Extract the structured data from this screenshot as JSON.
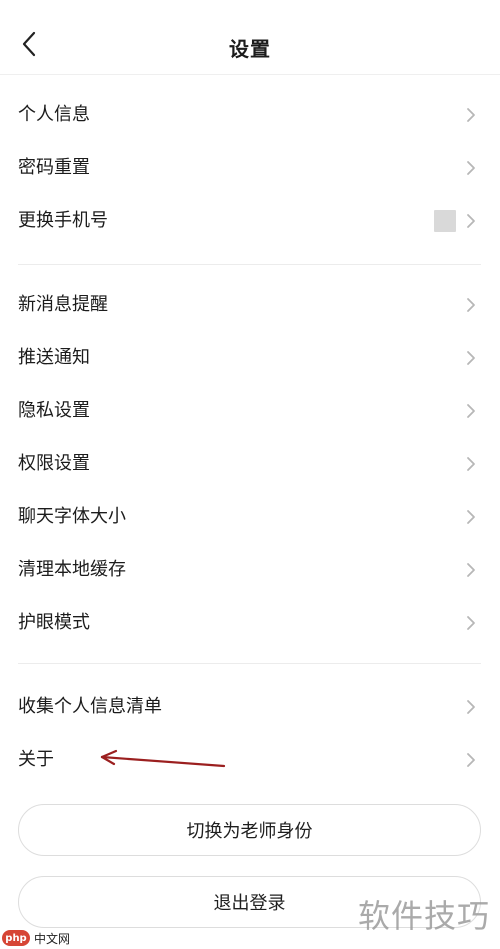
{
  "header": {
    "title": "设置",
    "back_icon": "chevron-left-icon"
  },
  "sections": [
    {
      "items": [
        {
          "label": "个人信息",
          "icon": "chevron-right-icon"
        },
        {
          "label": "密码重置",
          "icon": "chevron-right-icon"
        },
        {
          "label": "更换手机号",
          "icon": "chevron-right-icon"
        }
      ]
    },
    {
      "items": [
        {
          "label": "新消息提醒",
          "icon": "chevron-right-icon"
        },
        {
          "label": "推送通知",
          "icon": "chevron-right-icon"
        },
        {
          "label": "隐私设置",
          "icon": "chevron-right-icon"
        },
        {
          "label": "权限设置",
          "icon": "chevron-right-icon"
        },
        {
          "label": "聊天字体大小",
          "icon": "chevron-right-icon"
        },
        {
          "label": "清理本地缓存",
          "icon": "chevron-right-icon"
        },
        {
          "label": "护眼模式",
          "icon": "chevron-right-icon"
        }
      ]
    },
    {
      "items": [
        {
          "label": "收集个人信息清单",
          "icon": "chevron-right-icon"
        },
        {
          "label": "关于",
          "icon": "chevron-right-icon"
        }
      ]
    }
  ],
  "actions": {
    "switch_role": "切换为老师身份",
    "logout": "退出登录"
  },
  "overlays": {
    "watermark": "软件技巧",
    "badge_logo": "php",
    "badge_text": "中文网"
  },
  "colors": {
    "text_primary": "#1c1c1c",
    "chevron": "#b7b7b7",
    "divider": "#ececec",
    "button_border": "#dddddd",
    "annotation_arrow": "#9b1f1f"
  }
}
